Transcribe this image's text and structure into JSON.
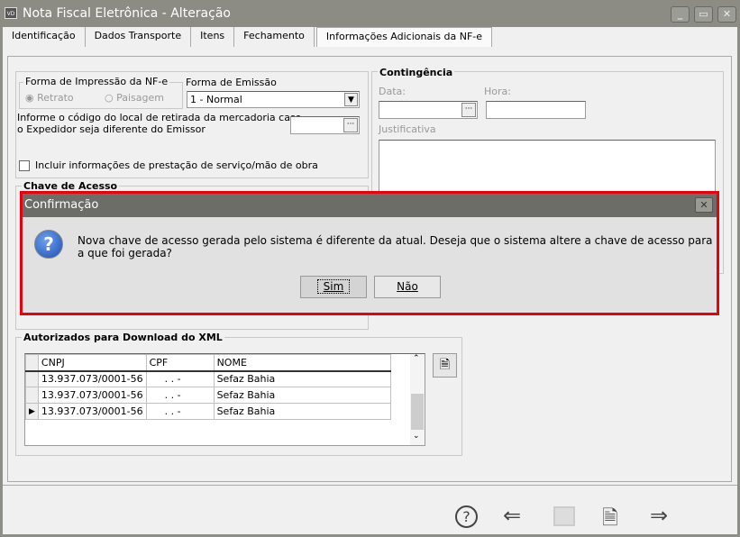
{
  "window": {
    "title": "Nota Fiscal Eletrônica - Alteração",
    "icon_text": "VD"
  },
  "tabs": [
    {
      "label": "Identificação"
    },
    {
      "label": "Dados Transporte"
    },
    {
      "label": "Itens"
    },
    {
      "label": "Fechamento"
    },
    {
      "label": "Informações Adicionais da NF-e",
      "active": true
    }
  ],
  "impressao": {
    "label": "Forma de Impressão da NF-e",
    "options": [
      "Retrato",
      "Paisagem"
    ],
    "selected": "Retrato"
  },
  "emissao": {
    "label": "Forma de Emissão",
    "value": "1 - Normal"
  },
  "retirada": {
    "label_line1": "Informe o código do local de retirada da mercadoria caso",
    "label_line2": "o Expedidor seja diferente do Emissor",
    "value": ""
  },
  "incluir_servico": {
    "label": "Incluir informações de prestação de serviço/mão de obra",
    "checked": false
  },
  "chave": {
    "label": "Chave de Acesso"
  },
  "contingencia": {
    "label": "Contingência",
    "data_label": "Data:",
    "hora_label": "Hora:",
    "justificativa_label": "Justificativa"
  },
  "autorizados": {
    "label": "Autorizados para Download do XML",
    "columns": [
      "CNPJ",
      "CPF",
      "NOME"
    ],
    "rows": [
      {
        "cnpj": "13.937.073/0001-56",
        "cpf": ". . -",
        "nome": "Sefaz Bahia"
      },
      {
        "cnpj": "13.937.073/0001-56",
        "cpf": ". . -",
        "nome": "Sefaz Bahia"
      },
      {
        "cnpj": "13.937.073/0001-56",
        "cpf": ". . -",
        "nome": "Sefaz Bahia",
        "current": true
      }
    ]
  },
  "dialog": {
    "title": "Confirmação",
    "message": "Nova chave de acesso gerada pelo sistema é diferente da atual. Deseja que o sistema altere a chave de acesso para a que foi gerada?",
    "yes": "Sim",
    "no": "Não",
    "icon": "question-icon"
  },
  "toolbar": {
    "icons": [
      "help-icon",
      "back-arrow-icon",
      "save-icon",
      "cancel-document-icon",
      "forward-arrow-icon"
    ]
  },
  "colors": {
    "highlight": "#e8000e",
    "titlebar": "#8c8c85"
  }
}
